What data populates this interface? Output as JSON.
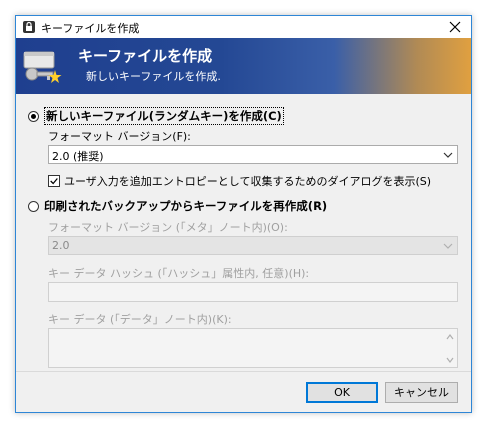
{
  "window": {
    "title": "キーファイルを作成",
    "close_icon": "close-icon"
  },
  "banner": {
    "title": "キーファイルを作成",
    "subtitle": "新しいキーファイルを作成.",
    "icon": "key-icon"
  },
  "option_new": {
    "label": "新しいキーファイル(ランダムキー)を作成(C)",
    "selected": true,
    "format_label": "フォーマット バージョン(F):",
    "format_value": "2.0 (推奨)",
    "checkbox_label": "ユーザ入力を追加エントロピーとして収集するためのダイアログを表示(S)",
    "checkbox_checked": true
  },
  "option_recreate": {
    "label": "印刷されたバックアップからキーファイルを再作成(R)",
    "selected": false,
    "format_label": "フォーマット バージョン (「メタ」ノート内)(O):",
    "format_value": "2.0",
    "hash_label": "キー データ ハッシュ (「ハッシュ」属性内, 任意)(H):",
    "hash_value": "",
    "data_label": "キー データ (「データ」ノート内)(K):",
    "data_value": ""
  },
  "buttons": {
    "ok": "OK",
    "cancel": "キャンセル"
  },
  "colors": {
    "accent": "#0078d7",
    "banner_start": "#1f3f8f",
    "banner_end": "#e0a040"
  }
}
